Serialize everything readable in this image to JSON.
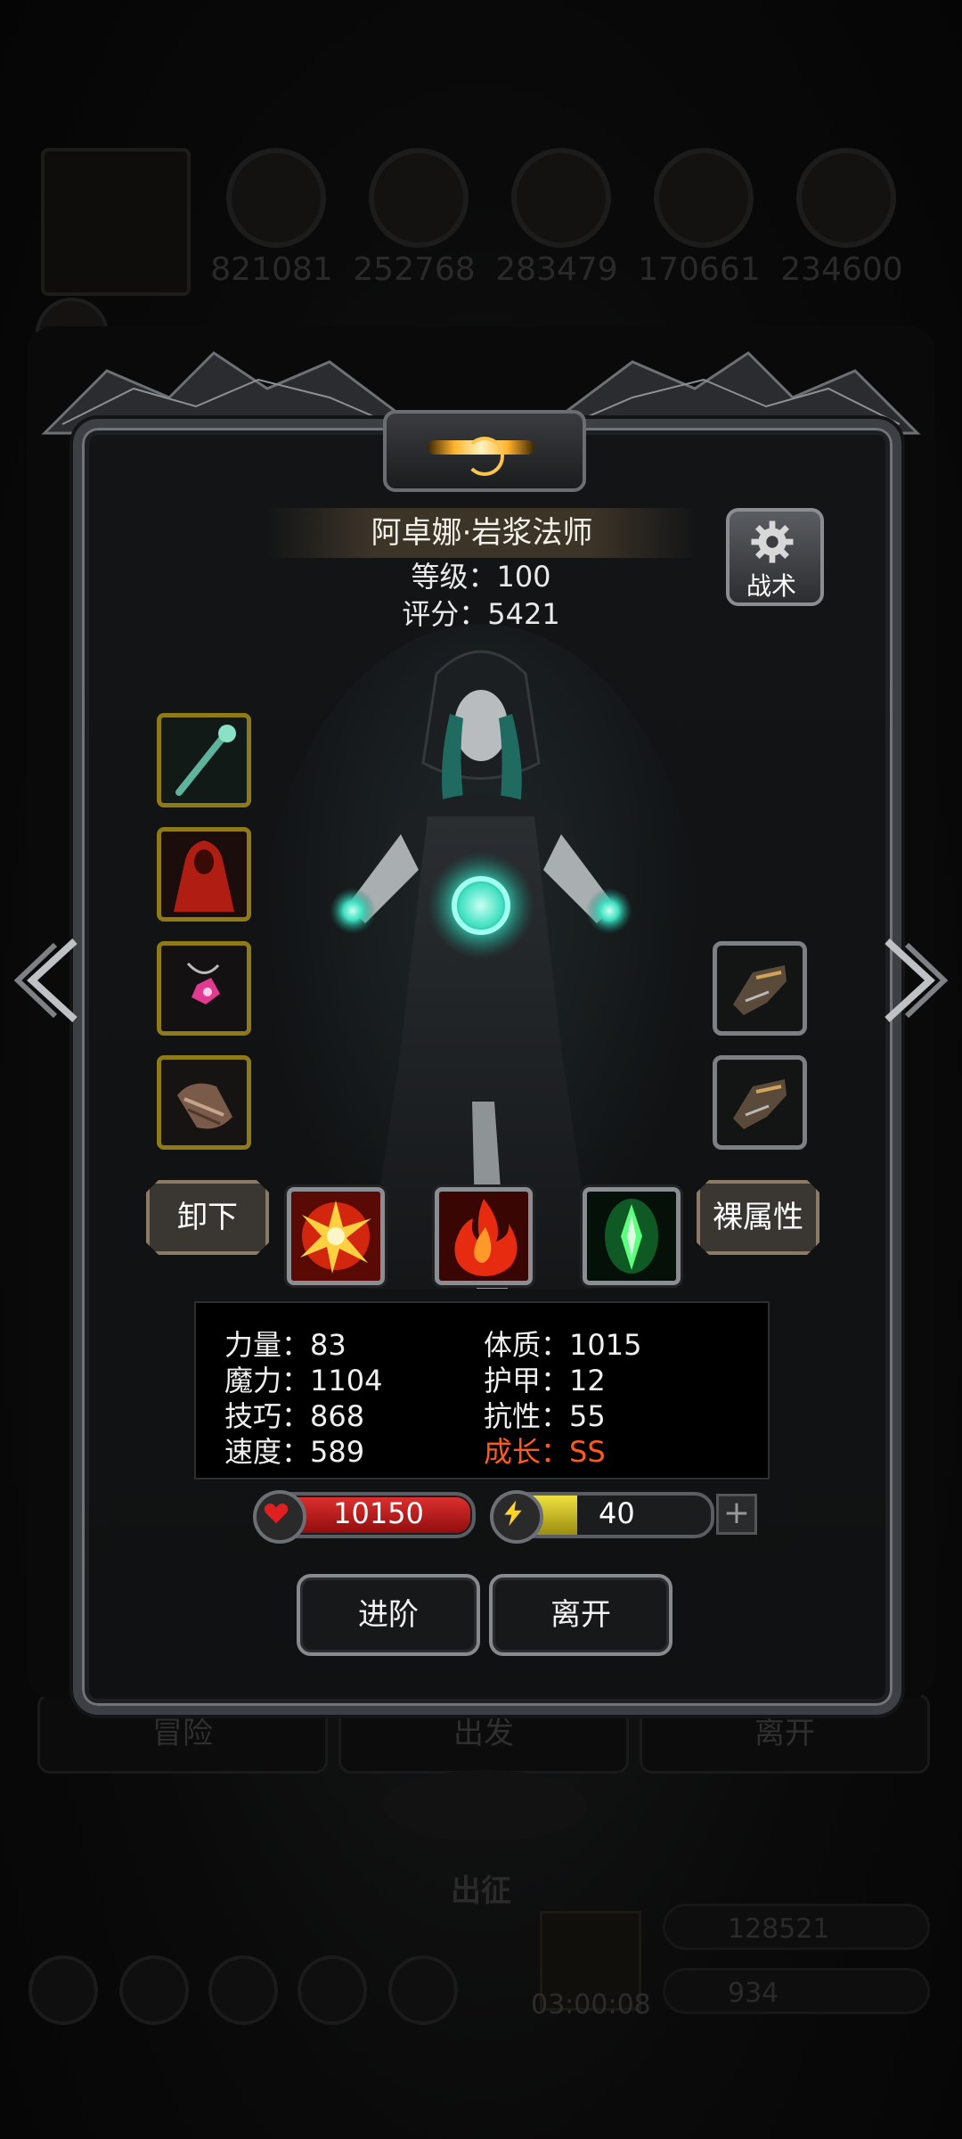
{
  "background": {
    "resources": [
      "821081",
      "252768",
      "283479",
      "170661",
      "234600"
    ],
    "nav_buttons": [
      "冒险",
      "出发",
      "离开"
    ],
    "section_title": "出征",
    "timer": "03:00:08",
    "gold": "128521",
    "gems": "934"
  },
  "hero": {
    "name": "阿卓娜·岩浆法师",
    "level_line": "等级：100",
    "score_line": "评分：5421"
  },
  "buttons": {
    "tactics": "战术",
    "unequip": "卸下",
    "base_stats": "裸属性",
    "advance": "进阶",
    "leave": "离开"
  },
  "stats": {
    "strength": "力量：83",
    "magic": "魔力：1104",
    "skill": "技巧：868",
    "speed": "速度：589",
    "constitution": "体质：1015",
    "armor": "护甲：12",
    "resistance": "抗性：55",
    "growth": "成长：SS"
  },
  "bars": {
    "hp_value": "10150",
    "energy_value": "40",
    "energy_fraction": 0.38
  },
  "icons": {
    "equipment": [
      "staff-icon",
      "red-cloak-icon",
      "pink-amulet-icon",
      "bracer-icon"
    ],
    "side_equipment": [
      "gauntlet-icon",
      "gauntlet-icon"
    ],
    "skills": [
      "fire-burst-icon",
      "flame-icon",
      "green-crystal-icon"
    ]
  },
  "colors": {
    "accent_gold": "#8f7a18",
    "growth_orange": "#ff5a1e",
    "hp_red": "#d42020",
    "energy_yellow": "#e8d830"
  }
}
